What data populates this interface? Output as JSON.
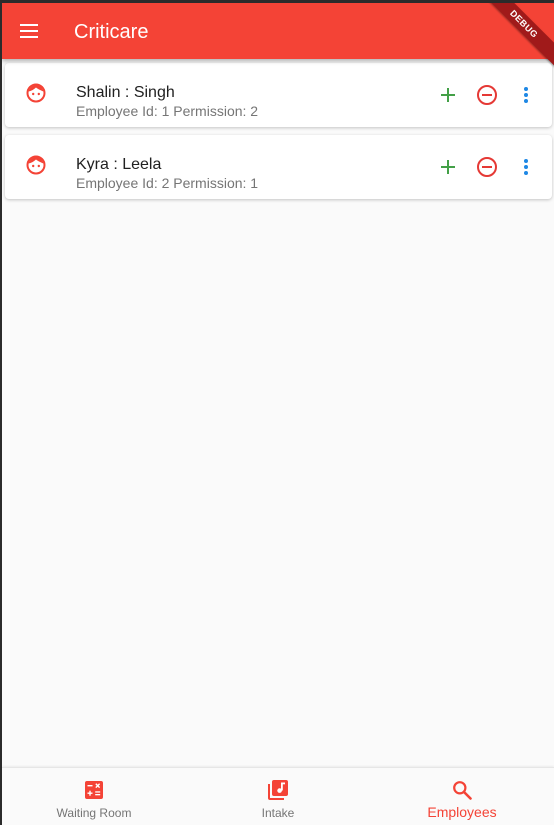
{
  "app_bar": {
    "title": "Criticare",
    "debug_label": "DEBUG",
    "menu_icon": "menu-icon",
    "color": "#f44336"
  },
  "employees": [
    {
      "name": "Shalin : Singh",
      "meta": "Employee Id: 1 Permission: 2",
      "avatar_icon": "face-icon"
    },
    {
      "name": "Kyra : Leela",
      "meta": "Employee Id: 2 Permission: 1",
      "avatar_icon": "face-icon"
    }
  ],
  "actions": {
    "add_icon": "plus-icon",
    "remove_icon": "minus-circle-icon",
    "more_icon": "more-vert-icon",
    "add_color": "#43a047",
    "remove_color": "#e53935",
    "more_color": "#1e88e5"
  },
  "bottom_nav": {
    "items": [
      {
        "label": "Waiting Room",
        "icon": "calculator-icon",
        "active": false
      },
      {
        "label": "Intake",
        "icon": "library-music-icon",
        "active": false
      },
      {
        "label": "Employees",
        "icon": "search-icon",
        "active": true
      }
    ],
    "active_color": "#f44336",
    "inactive_color": "#757575"
  }
}
